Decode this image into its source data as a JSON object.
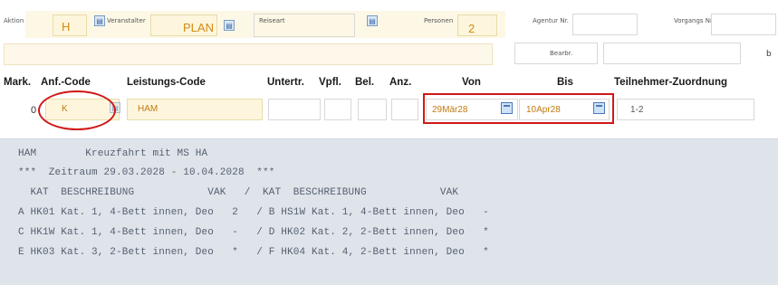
{
  "form": {
    "aktion_label": "Aktion",
    "aktion_value": "H",
    "veranstalter_label": "Veranstalter",
    "veranstalter_value": "PLAN",
    "reiseart_label": "Reiseart",
    "personen_label": "Personen",
    "personen_value": "2",
    "agentur_label": "Agentur Nr.",
    "vorgangs_label": "Vorgangs Nr.",
    "bearbeiter_label": "Bearbr.",
    "edge_letter": "b"
  },
  "table": {
    "headers": {
      "mark": "Mark.",
      "anf_code": "Anf.-Code",
      "leistungs_code": "Leistungs-Code",
      "untertr": "Untertr.",
      "vpfl": "Vpfl.",
      "bel": "Bel.",
      "anz": "Anz.",
      "von": "Von",
      "bis": "Bis",
      "teilnehmer": "Teilnehmer-Zuordnung"
    },
    "row": {
      "mark": "0",
      "anf_code": "K",
      "leistungs_code": "HAM",
      "von": "29Mär28",
      "bis": "10Apr28",
      "teilnehmer": "1-2"
    }
  },
  "highlight_colors": {
    "circle": "#d01818",
    "rect": "#d01818"
  },
  "terminal": {
    "lines": [
      "HAM        Kreuzfahrt mit MS HA",
      "***  Zeitraum 29.03.2028 - 10.04.2028  ***",
      "  KAT  BESCHREIBUNG            VAK   /  KAT  BESCHREIBUNG            VAK",
      "A HK01 Kat. 1, 4-Bett innen, Deo   2   / B HS1W Kat. 1, 4-Bett innen, Deo   -",
      "C HK1W Kat. 1, 4-Bett innen, Deo   -   / D HK02 Kat. 2, 2-Bett innen, Deo   *",
      "E HK03 Kat. 3, 2-Bett innen, Deo   *   / F HK04 Kat. 4, 2-Bett innen, Deo   *"
    ]
  }
}
